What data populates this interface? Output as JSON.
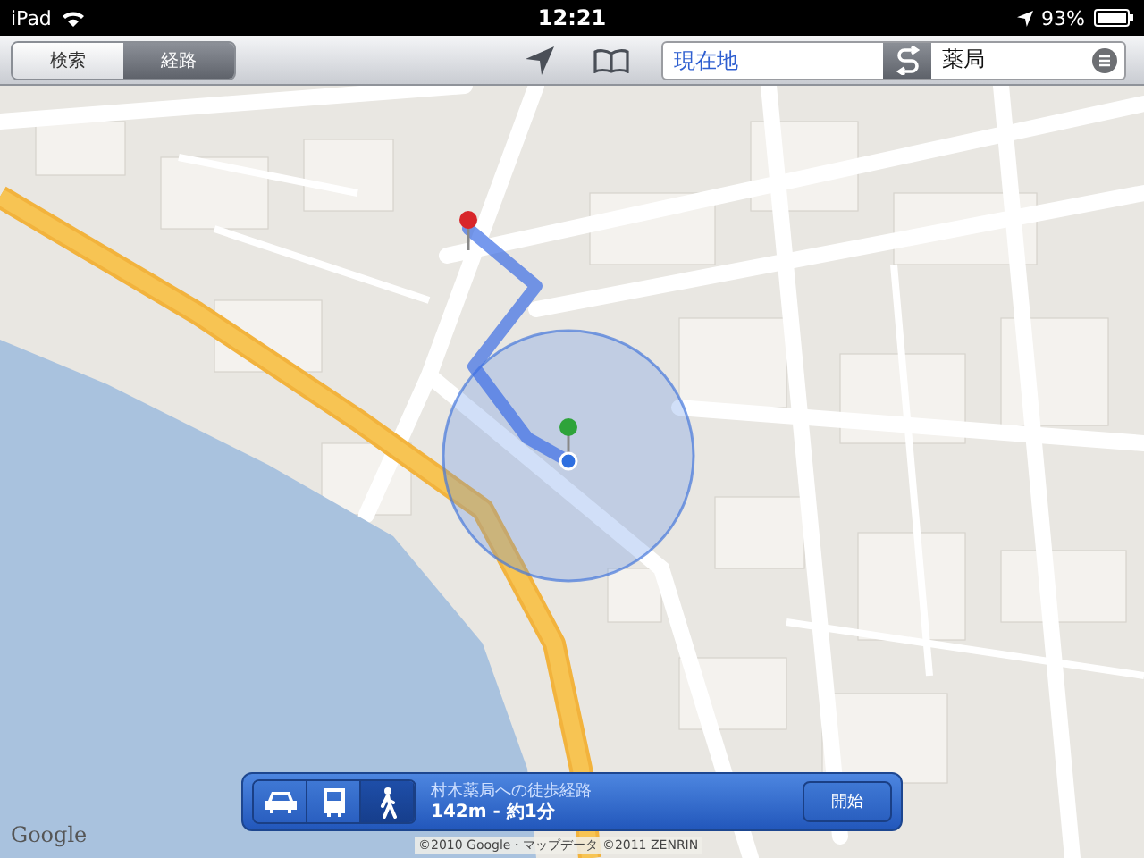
{
  "status_bar": {
    "device": "iPad",
    "time": "12:21",
    "battery": "93%"
  },
  "toolbar": {
    "segments": [
      {
        "label": "検索",
        "selected": false
      },
      {
        "label": "経路",
        "selected": true
      }
    ],
    "route_from": "現在地",
    "route_to": "薬局"
  },
  "map": {
    "logo": "Google",
    "copyright": "©2010 Google・マップデータ ©2011 ZENRIN"
  },
  "route_panel": {
    "modes": [
      {
        "kind": "car",
        "selected": false
      },
      {
        "kind": "bus",
        "selected": false
      },
      {
        "kind": "walk",
        "selected": true
      }
    ],
    "title": "村木薬局への徒歩経路",
    "summary": "142m - 約1分",
    "start_button": "開始"
  }
}
